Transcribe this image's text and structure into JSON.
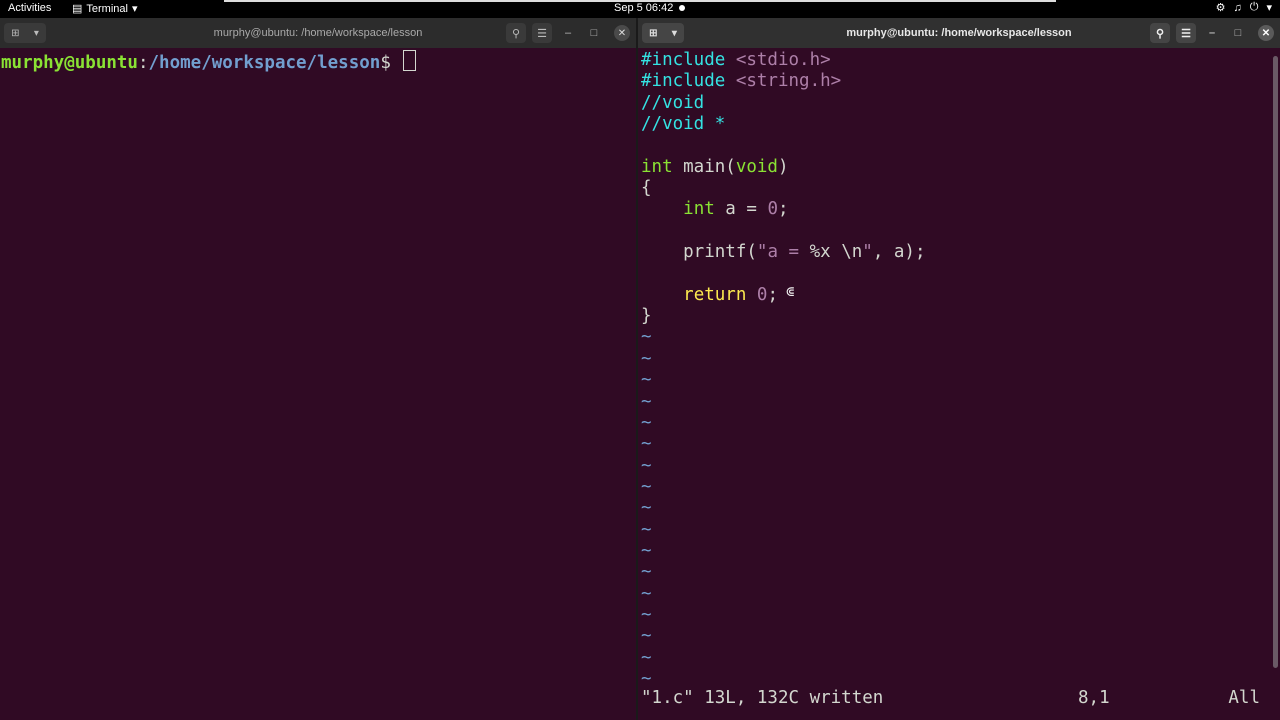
{
  "topbar": {
    "activities": "Activities",
    "app_name": "Terminal",
    "clock": "Sep 5  06:42"
  },
  "left_window": {
    "title": "murphy@ubuntu: /home/workspace/lesson",
    "prompt_user": "murphy@ubuntu",
    "prompt_sep": ":",
    "prompt_path": "/home/workspace/lesson",
    "prompt_symbol": "$ "
  },
  "right_window": {
    "title": "murphy@ubuntu: /home/workspace/lesson",
    "code": {
      "l1a": "#include ",
      "l1b": "<stdio.h>",
      "l2a": "#include ",
      "l2b": "<string.h>",
      "l3": "//void",
      "l4": "//void *",
      "l6a": "int",
      "l6b": " main(",
      "l6c": "void",
      "l6d": ")",
      "l7": "{",
      "l8a": "    ",
      "l8b": "int",
      "l8c": " a = ",
      "l8d": "0",
      "l8e": ";",
      "l10a": "    printf(",
      "l10b": "\"a = ",
      "l10c": "%x \\n",
      "l10d": "\"",
      "l10e": ", a);",
      "l12a": "    ",
      "l12b": "return",
      "l12c": " ",
      "l12d": "0",
      "l12e": ";",
      "l13": "}",
      "tilde": "~"
    },
    "status_msg": "\"1.c\" 13L, 132C written",
    "status_pos": "8,1",
    "status_all": "All"
  },
  "colors": {
    "terminal_bg": "#300a24",
    "prompt_user": "#8ae234",
    "prompt_path": "#729fcf"
  }
}
